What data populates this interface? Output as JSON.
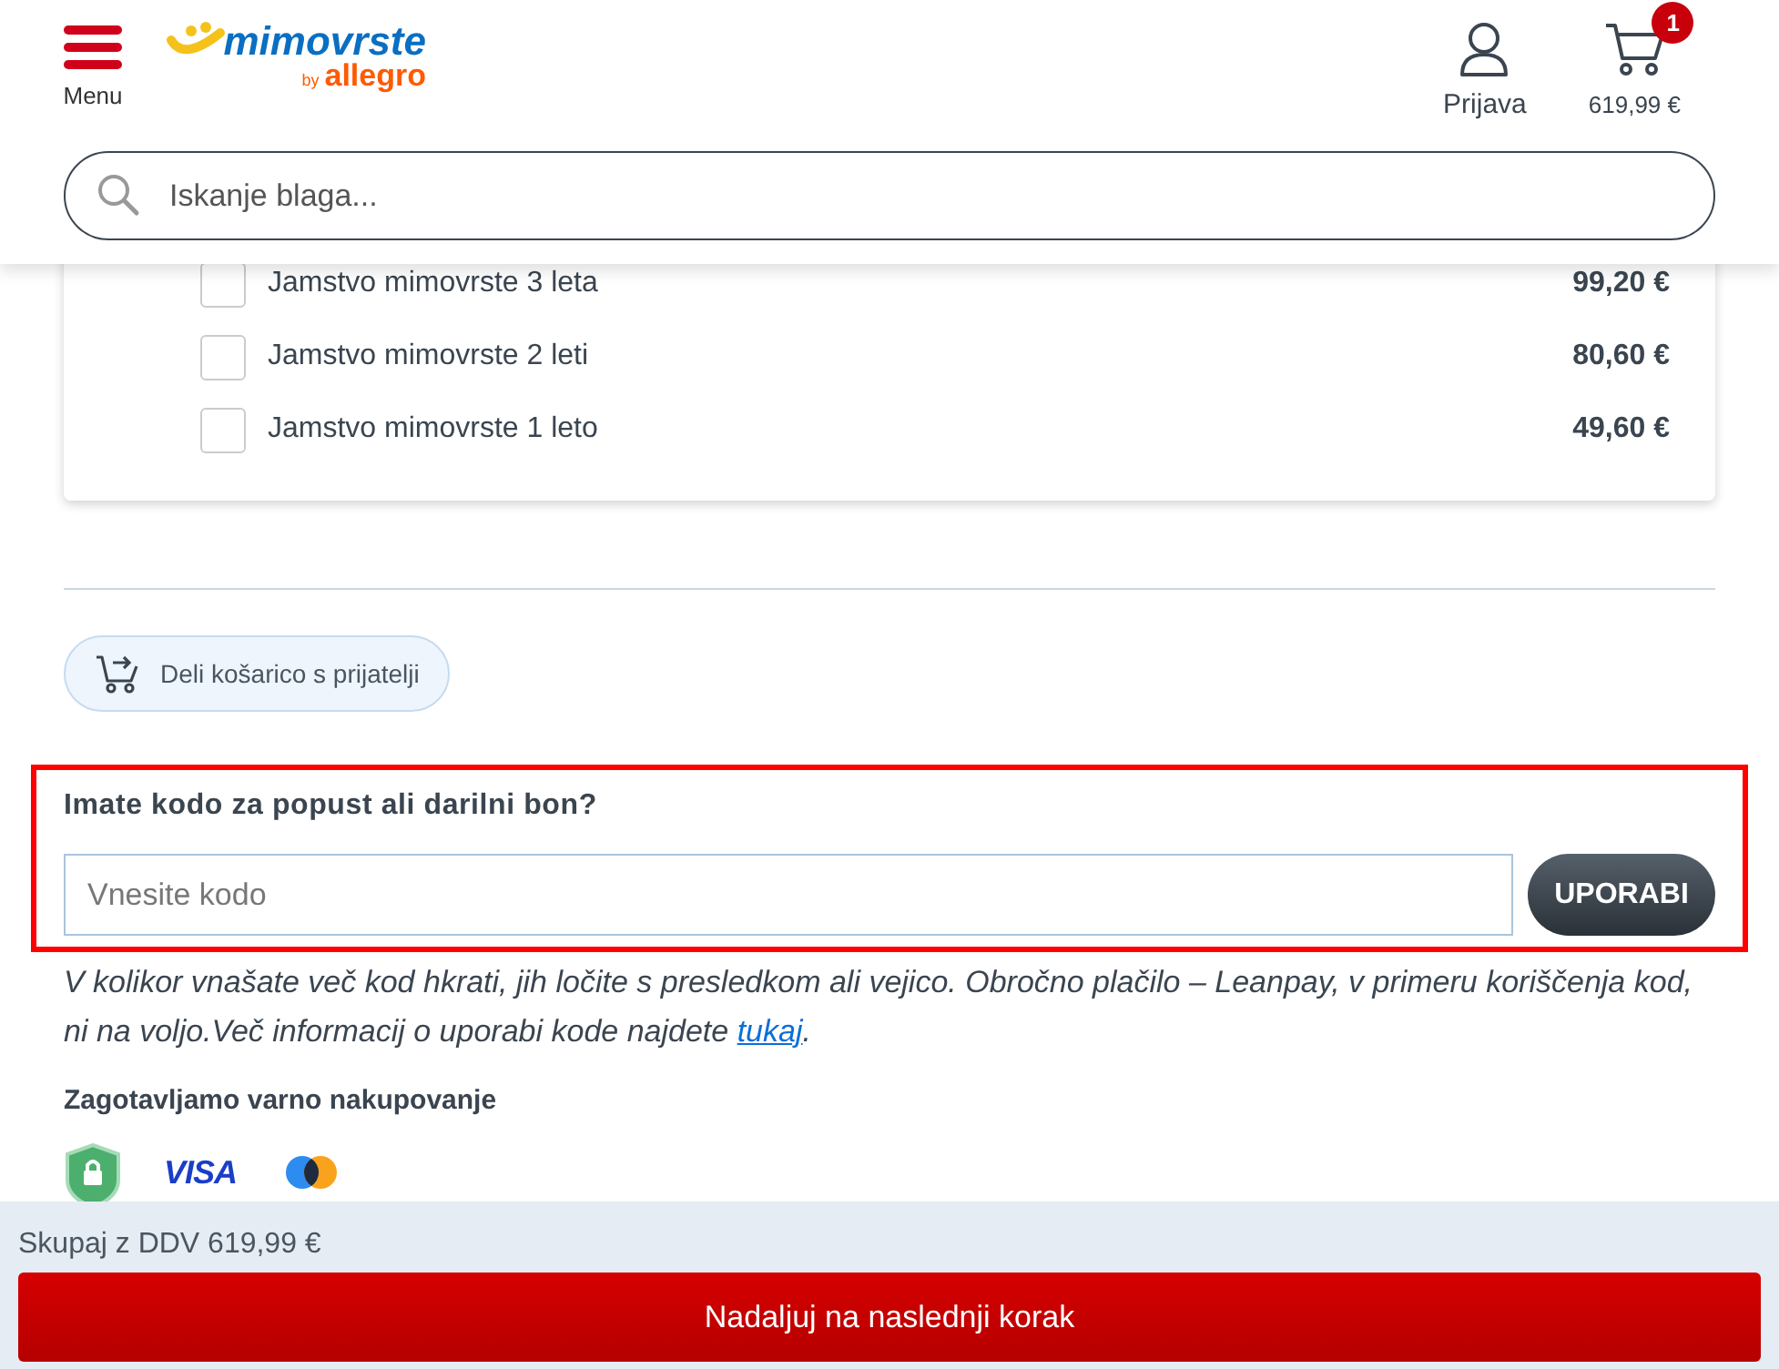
{
  "header": {
    "menu_label": "Menu",
    "logo": {
      "name": "mimovrste",
      "by": "by",
      "brand": "allegro"
    },
    "login_label": "Prijava",
    "cart": {
      "count": "1",
      "total": "619,99 €"
    }
  },
  "search": {
    "placeholder": "Iskanje blaga..."
  },
  "warranty_options": [
    {
      "label": "Jamstvo mimovrste 3 leta",
      "price": "99,20 €",
      "checked": false
    },
    {
      "label": "Jamstvo mimovrste 2 leti",
      "price": "80,60 €",
      "checked": false
    },
    {
      "label": "Jamstvo mimovrste 1 leto",
      "price": "49,60 €",
      "checked": false
    }
  ],
  "share_button": "Deli košarico s prijatelji",
  "voucher": {
    "title": "Imate kodo za popust ali darilni bon?",
    "placeholder": "Vnesite kodo",
    "button": "UPORABI",
    "help": "V kolikor vnašate več kod hkrati, jih ločite s presledkom ali vejico. Obročno plačilo – Leanpay, v primeru koriščenja kod, ni na voljo.Več informacij o uporabi kode najdete ",
    "link": "tukaj",
    "help_end": "."
  },
  "secure": {
    "title": "Zagotavljamo varno nakupovanje",
    "visa": "VISA"
  },
  "footer": {
    "total": "Skupaj z DDV 619,99 €",
    "next_button": "Nadaljuj na naslednji korak"
  }
}
